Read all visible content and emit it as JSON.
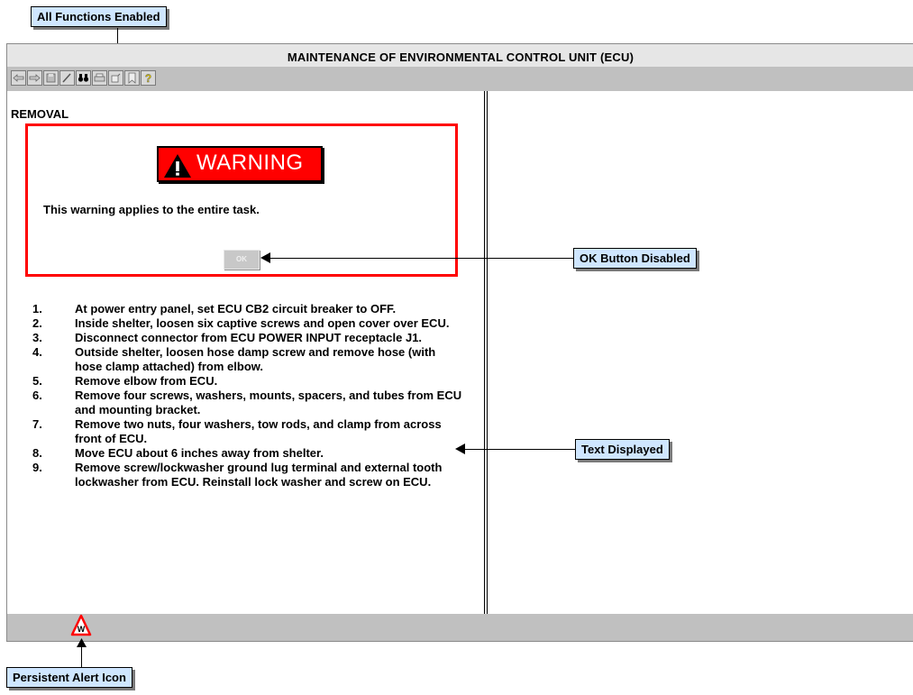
{
  "callouts": {
    "all_functions": "All Functions Enabled",
    "ok_disabled": "OK Button Disabled",
    "text_displayed": "Text Displayed",
    "persistent_alert": "Persistent Alert Icon"
  },
  "window": {
    "title": "MAINTENANCE OF ENVIRONMENTAL CONTROL UNIT (ECU)"
  },
  "toolbar": {
    "icons": [
      "back-arrow-icon",
      "forward-arrow-icon",
      "save-icon",
      "edit-icon",
      "binoculars-icon",
      "print-icon",
      "note-icon",
      "bookmark-icon",
      "help-icon"
    ]
  },
  "content": {
    "section_heading": "REMOVAL",
    "warning": {
      "banner_text": "WARNING",
      "message": "This warning applies to the entire task.",
      "ok_label": "OK",
      "ok_enabled": false
    },
    "steps": [
      {
        "num": "1.",
        "text": "At power entry panel, set ECU CB2 circuit breaker to OFF."
      },
      {
        "num": "2.",
        "text": "Inside shelter, loosen six captive screws and open cover over ECU."
      },
      {
        "num": "3.",
        "text": "Disconnect connector from ECU POWER INPUT receptacle J1."
      },
      {
        "num": "4.",
        "text": "Outside shelter, loosen hose damp screw and remove hose (with hose clamp attached) from elbow."
      },
      {
        "num": "5.",
        "text": "Remove elbow from ECU."
      },
      {
        "num": "6.",
        "text": "Remove four screws, washers, mounts, spacers, and tubes from ECU and mounting bracket."
      },
      {
        "num": "7.",
        "text": "Remove two nuts, four washers, tow rods, and clamp from across front of ECU."
      },
      {
        "num": "8.",
        "text": "Move ECU about 6 inches away from shelter."
      },
      {
        "num": "9.",
        "text": "Remove screw/lockwasher ground lug terminal and external tooth lockwasher from ECU. Reinstall lock washer and screw on ECU."
      }
    ]
  },
  "alert_icon": {
    "letter": "W",
    "color": "#ff0000"
  }
}
